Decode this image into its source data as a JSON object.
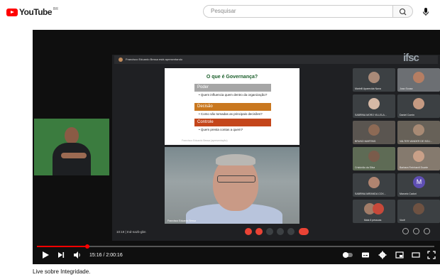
{
  "header": {
    "logo_text": "YouTube",
    "logo_country": "BR",
    "search_placeholder": "Pesquisar"
  },
  "meet": {
    "presenting_text": "Francisco Eduardo Bessa está apresentando",
    "watermark": "ifsc",
    "meeting_time": "10:19",
    "meeting_code": "tnd-nazb-gbn",
    "presenter_label": "Francisco Eduardo Bessa"
  },
  "slide": {
    "title": "O que é Governança?",
    "sections": [
      {
        "label": "Poder",
        "color": "#a6a6a6",
        "bullet": "Quem influencia quem dentro da organização?"
      },
      {
        "label": "Decisão",
        "color": "#c9781f",
        "bullet": "Como são tomadas as principais decisões?"
      },
      {
        "label": "Controle",
        "color": "#c4461b",
        "bullet": "Quem presta contas a quem?"
      }
    ],
    "footer": "Francisco Eduardo Bessa (apresentação)"
  },
  "participants": [
    {
      "name": "Marielli Aparecida Nava"
    },
    {
      "name": "Joao Sousa"
    },
    {
      "name": "SABRINA MORO VILLELA..."
    },
    {
      "name": "Daniel Comin"
    },
    {
      "name": "BRUNO MARTINS"
    },
    {
      "name": "VALTER VANDER DE SOU..."
    },
    {
      "name": "Cristóvão da Silva"
    },
    {
      "name": "Barbara Reinhardt Duarte"
    },
    {
      "name": "SABRINA MIRANDA COX..."
    },
    {
      "name": "Marcelo Cadori",
      "initial": "M"
    },
    {
      "name": "Mais 6 pessoas"
    },
    {
      "name": "Você"
    }
  ],
  "player": {
    "current_time": "15:16",
    "duration": "2:00:16",
    "time_display": "15:16 / 2:00:16",
    "progress_fraction": 0.127
  },
  "video_title": "Live sobre Integridade."
}
